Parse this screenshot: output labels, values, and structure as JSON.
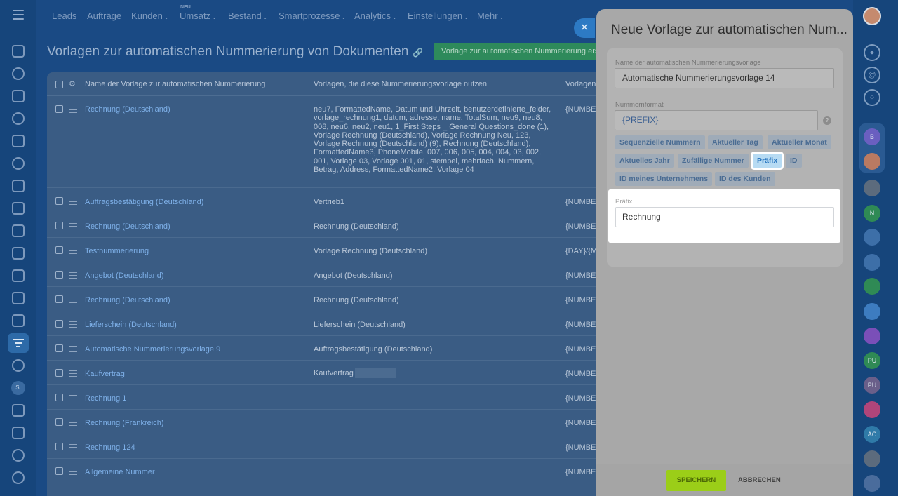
{
  "nav": {
    "items": [
      {
        "label": "Leads",
        "chevron": false
      },
      {
        "label": "Aufträge",
        "chevron": false
      },
      {
        "label": "Kunden",
        "chevron": true
      },
      {
        "label": "Umsatz",
        "chevron": true
      },
      {
        "label": "Bestand",
        "chevron": true
      },
      {
        "label": "Smartprozesse",
        "chevron": true
      },
      {
        "label": "Analytics",
        "chevron": true
      },
      {
        "label": "Einstellungen",
        "chevron": true
      },
      {
        "label": "Mehr",
        "chevron": true
      }
    ],
    "new_badge": "NEU"
  },
  "page": {
    "title": "Vorlagen zur automatischen Nummerierung von Dokumenten",
    "create_button": "Vorlage zur automatischen Nummerierung erstellen"
  },
  "table": {
    "headers": {
      "name": "Name der Vorlage zur automatischen Nummerierung",
      "used": "Vorlagen, die diese Nummerierungsvorlage nutzen",
      "format": "Vorlagen"
    },
    "rows": [
      {
        "name": "Rechnung (Deutschland)",
        "used": "neu7, FormattedName, Datum und Uhrzeit, benutzerdefinierte_felder, vorlage_rechnung1, datum, adresse, name, TotalSum, neu9, neu8, 008, neu6, neu2, neu1, 1_First Steps _ General Questions_done (1), Vorlage Rechnung (Deutschland), Vorlage Rechnung Neu, 123, Vorlage Rechnung (Deutschland) (9), Rechnung (Deutschland), FormattedName3, PhoneMobile, 007, 006, 005, 004, 004, 03, 002, 001, Vorlage 03, Vorlage 001, 01, stempel, mehrfach, Nummern, Betrag, Address, FormattedName2, Vorlage 04",
        "format": "{NUMBE"
      },
      {
        "name": "Auftragsbestätigung (Deutschland)",
        "used": "Vertrieb1",
        "format": "{NUMBE"
      },
      {
        "name": "Rechnung (Deutschland)",
        "used": "Rechnung (Deutschland)",
        "format": "{NUMBE"
      },
      {
        "name": "Testnummerierung",
        "used": "Vorlage Rechnung (Deutschland)",
        "format": "{DAY}/{M"
      },
      {
        "name": "Angebot (Deutschland)",
        "used": "Angebot (Deutschland)",
        "format": "{NUMBE"
      },
      {
        "name": "Rechnung (Deutschland)",
        "used": "Rechnung (Deutschland)",
        "format": "{NUMBE"
      },
      {
        "name": "Lieferschein (Deutschland)",
        "used": "Lieferschein (Deutschland)",
        "format": "{NUMBE"
      },
      {
        "name": "Automatische Nummerierungsvorlage 9",
        "used": "Auftragsbestätigung (Deutschland)",
        "format": "{NUMBE"
      },
      {
        "name": "Kaufvertrag",
        "used": "Kaufvertrag",
        "format": "{NUMBE"
      },
      {
        "name": "Rechnung 1",
        "used": "",
        "format": "{NUMBE"
      },
      {
        "name": "Rechnung (Frankreich)",
        "used": "",
        "format": "{NUMBE"
      },
      {
        "name": "Rechnung 124",
        "used": "",
        "format": "{NUMBE"
      },
      {
        "name": "Allgemeine Nummer",
        "used": "",
        "format": "{NUMBE"
      }
    ]
  },
  "slider": {
    "title": "Neue Vorlage zur automatischen Num...",
    "name_label": "Name der automatischen Nummerierungsvorlage",
    "name_value": "Automatische Nummerierungsvorlage  14",
    "format_label": "Nummernformat",
    "format_value": "{PREFIX}",
    "tags": [
      "Sequenzielle Nummern",
      "Aktueller Tag",
      "Aktueller Monat",
      "Aktuelles Jahr",
      "Zufällige Nummer",
      "Präfix",
      "ID",
      "ID meines Unternehmens",
      "ID des Kunden"
    ],
    "active_tag": "Präfix",
    "prefix_label": "Präfix",
    "prefix_value": "Rechnung",
    "save_button": "SPEICHERN",
    "cancel_button": "ABBRECHEN",
    "help_glyph": "?"
  },
  "rightbar": {
    "avatars": [
      "B",
      "N",
      "PU",
      "PU",
      "AC"
    ]
  },
  "leftbar": {
    "badge": "SI"
  },
  "colors": {
    "background": "#1a4a84",
    "link": "#7eb0e8",
    "save_button": "#9bce18",
    "active_tag": "#2a77c0"
  }
}
